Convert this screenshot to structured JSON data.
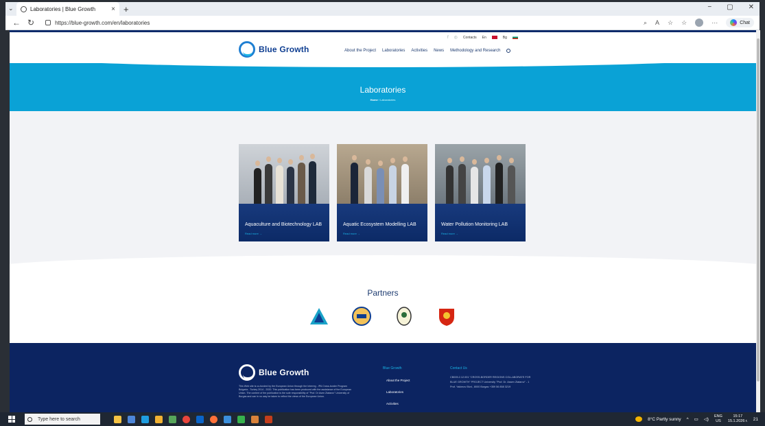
{
  "browser": {
    "tab_title": "Laboratories | Blue Growth",
    "url": "https://blue-growth.com/en/laboratories",
    "chat_label": "Chat"
  },
  "site": {
    "logo_text": "Blue Growth",
    "util": {
      "contacts": "Contacts",
      "lang_en": "En",
      "lang_bg": "Bg"
    },
    "nav": [
      "About the Project",
      "Laboratories",
      "Activities",
      "News",
      "Methodology and Research"
    ]
  },
  "hero": {
    "title": "Laboratories",
    "crumb_home": "Home",
    "crumb_current": "Laboratories"
  },
  "cards": [
    {
      "title": "Aquaculture and Biotechnology LAB",
      "more": "Read more"
    },
    {
      "title": "Aquatic Ecosystem Modelling LAB",
      "more": "Read more"
    },
    {
      "title": "Water Pollution Monitoring LAB",
      "more": "Read more"
    }
  ],
  "partners": {
    "title": "Partners"
  },
  "footer": {
    "logo_text": "Blue Growth",
    "text": "This Web site is co-funded by the European Union through the Interreg - IPA Cross-border Program Bulgaria - Turkey 2014 - 2020. This publication has been produced with the assistance of the European Union. The content of the publication is the sole responsibility of \"Prof. Dr Asen Zlatarov\" University of Burgas and can in no way be taken to reflect the views of the European Union.",
    "col1_title": "Blue Growth",
    "links": [
      "About the Project",
      "Laboratories",
      "Activities"
    ],
    "col2_title": "Contact Us",
    "contact": "CB005.2.12.001 \"CROSS-BORDER REGIONS COLLABORATE FOR BLUE GROWTH\" PROJECT University \"Prof. Dr. Assen Zlatarov\" - 1 Prof. Yakimov Blvd., 8000 Burgas +359 56 858 3219"
  },
  "taskbar": {
    "search_placeholder": "Type here to search",
    "weather": "8°C  Partly sunny",
    "lang": "ENG",
    "region": "US",
    "time": "15:17",
    "date": "15.1.2026 г.",
    "notif": "21"
  }
}
